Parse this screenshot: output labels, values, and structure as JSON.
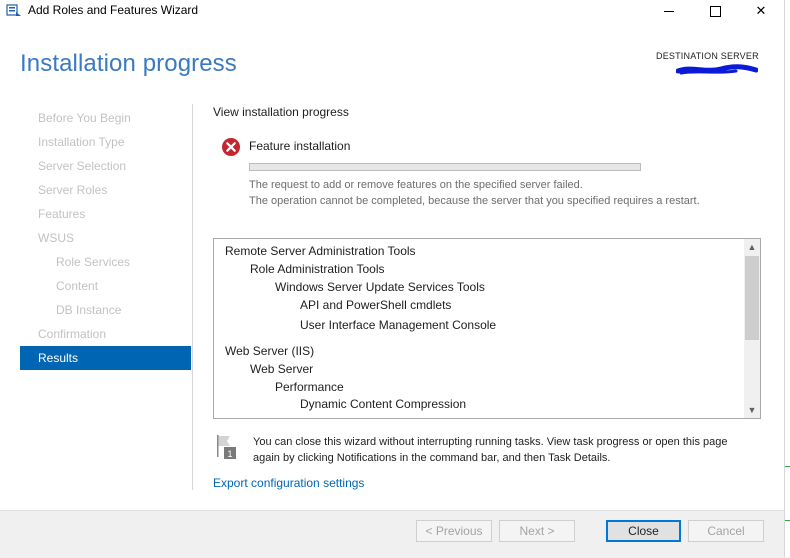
{
  "window": {
    "title": "Add Roles and Features Wizard",
    "controls": {
      "minimize": "minimize",
      "maximize": "maximize",
      "close": "✕"
    }
  },
  "header": {
    "page_title": "Installation progress",
    "destination_label": "DESTINATION SERVER"
  },
  "nav": {
    "items": [
      {
        "label": "Before You Begin",
        "state": "disabled",
        "indent": false
      },
      {
        "label": "Installation Type",
        "state": "disabled",
        "indent": false
      },
      {
        "label": "Server Selection",
        "state": "disabled",
        "indent": false
      },
      {
        "label": "Server Roles",
        "state": "disabled",
        "indent": false
      },
      {
        "label": "Features",
        "state": "disabled",
        "indent": false
      },
      {
        "label": "WSUS",
        "state": "disabled",
        "indent": false
      },
      {
        "label": "Role Services",
        "state": "disabled",
        "indent": true
      },
      {
        "label": "Content",
        "state": "disabled",
        "indent": true
      },
      {
        "label": "DB Instance",
        "state": "disabled",
        "indent": true
      },
      {
        "label": "Confirmation",
        "state": "disabled",
        "indent": false
      },
      {
        "label": "Results",
        "state": "active",
        "indent": false
      }
    ]
  },
  "main": {
    "section_label": "View installation progress",
    "status_icon": "error-icon",
    "feature_label": "Feature installation",
    "progress_fraction": 0,
    "message_line1": "The request to add or remove features on the specified server failed.",
    "message_line2": "The operation cannot be completed, because the server that you specified requires a restart.",
    "features": [
      {
        "label": "Remote Server Administration Tools",
        "level": 0
      },
      {
        "label": "Role Administration Tools",
        "level": 1
      },
      {
        "label": "Windows Server Update Services Tools",
        "level": 2
      },
      {
        "label": "API and PowerShell cmdlets",
        "level": 3
      },
      {
        "label": "User Interface Management Console",
        "level": 3
      },
      {
        "label": "Web Server (IIS)",
        "level": 0
      },
      {
        "label": "Web Server",
        "level": 1
      },
      {
        "label": "Performance",
        "level": 2
      },
      {
        "label": "Dynamic Content Compression",
        "level": 3
      }
    ],
    "note_text": "You can close this wizard without interrupting running tasks. View task progress or open this page again by clicking Notifications in the command bar, and then Task Details.",
    "note_icon": "notification-flag-icon",
    "note_badge": "1",
    "export_link": "Export configuration settings"
  },
  "buttons": {
    "previous": "< Previous",
    "next": "Next >",
    "close": "Close",
    "cancel": "Cancel"
  },
  "colors": {
    "accent": "#0066b3",
    "title": "#3a7abf",
    "error": "#c4262e"
  }
}
